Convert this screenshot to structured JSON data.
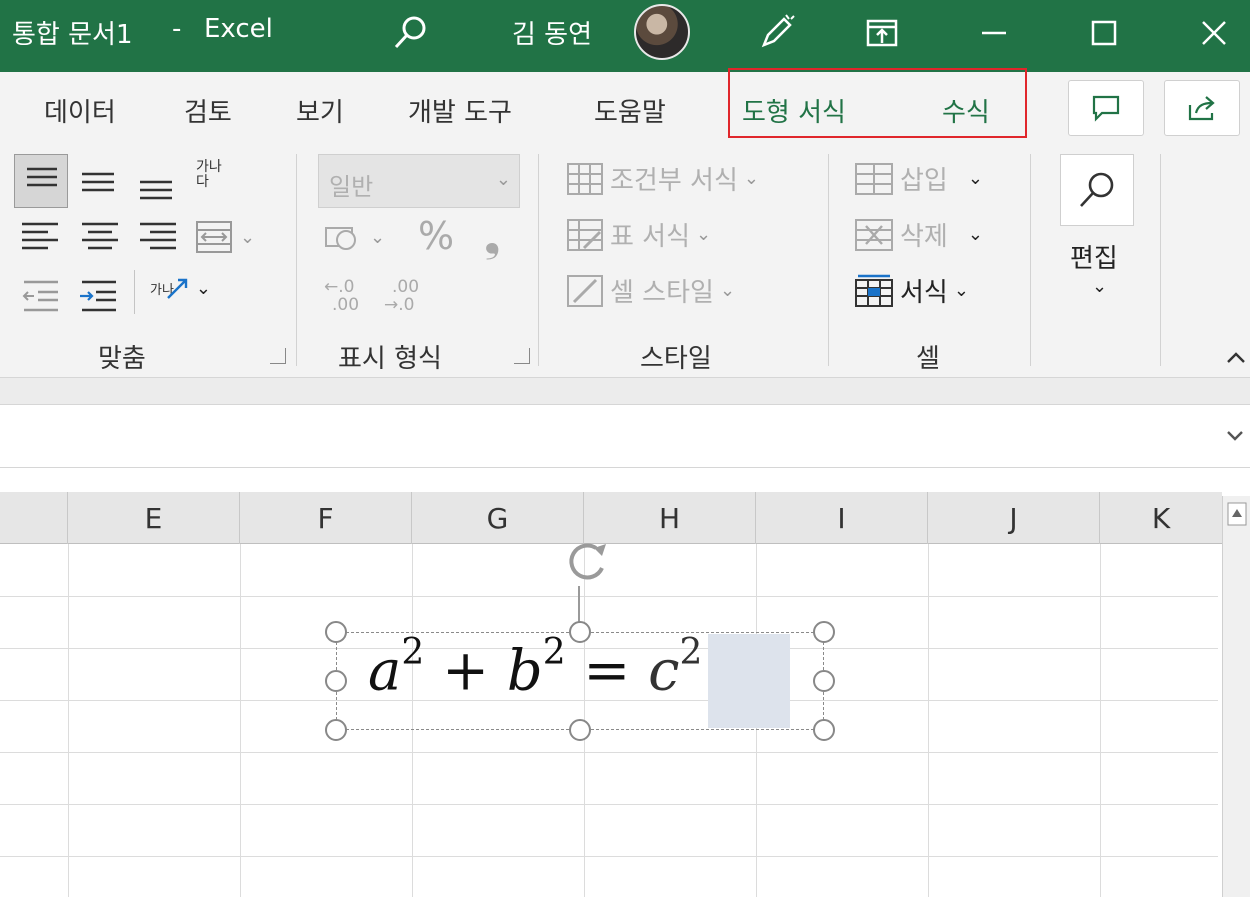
{
  "title_bar": {
    "document_title": "통합 문서1",
    "separator": "-",
    "app_name": "Excel",
    "user_name": "김 동연",
    "icons": [
      "search-icon",
      "avatar",
      "pen-icon",
      "ribbon-display-icon",
      "minimize-icon",
      "maximize-icon",
      "close-icon"
    ],
    "accent_color": "#217346"
  },
  "ribbon_tabs": {
    "items": [
      {
        "label": "데이터"
      },
      {
        "label": "검토"
      },
      {
        "label": "보기"
      },
      {
        "label": "개발 도구"
      },
      {
        "label": "도움말"
      }
    ],
    "contextual": [
      {
        "label": "도형 서식"
      },
      {
        "label": "수식"
      }
    ],
    "highlight_color": "#e0262b"
  },
  "ribbon": {
    "alignment": {
      "label": "맞춤",
      "wrap_hint": "가나\n다",
      "orientation_hint": "가나"
    },
    "number": {
      "label": "표시 형식",
      "format_value": "일반",
      "percent": "%",
      "comma": "❟",
      "inc_decimal_top": "←.0",
      "inc_decimal_bottom": ".00",
      "dec_decimal_top": ".00",
      "dec_decimal_bottom": "→.0"
    },
    "styles": {
      "label": "스타일",
      "conditional": "조건부 서식",
      "table": "표 서식",
      "cell_styles": "셀 스타일"
    },
    "cells": {
      "label": "셀",
      "insert": "삽입",
      "delete": "삭제",
      "format": "서식"
    },
    "editing": {
      "label": "편집"
    }
  },
  "grid": {
    "columns": [
      "E",
      "F",
      "G",
      "H",
      "I",
      "J",
      "K"
    ]
  },
  "equation": {
    "a": "a",
    "sup1": "2",
    "plus": "+",
    "b": "b",
    "sup2": "2",
    "eq": "=",
    "c": "c",
    "sup3": "2"
  }
}
